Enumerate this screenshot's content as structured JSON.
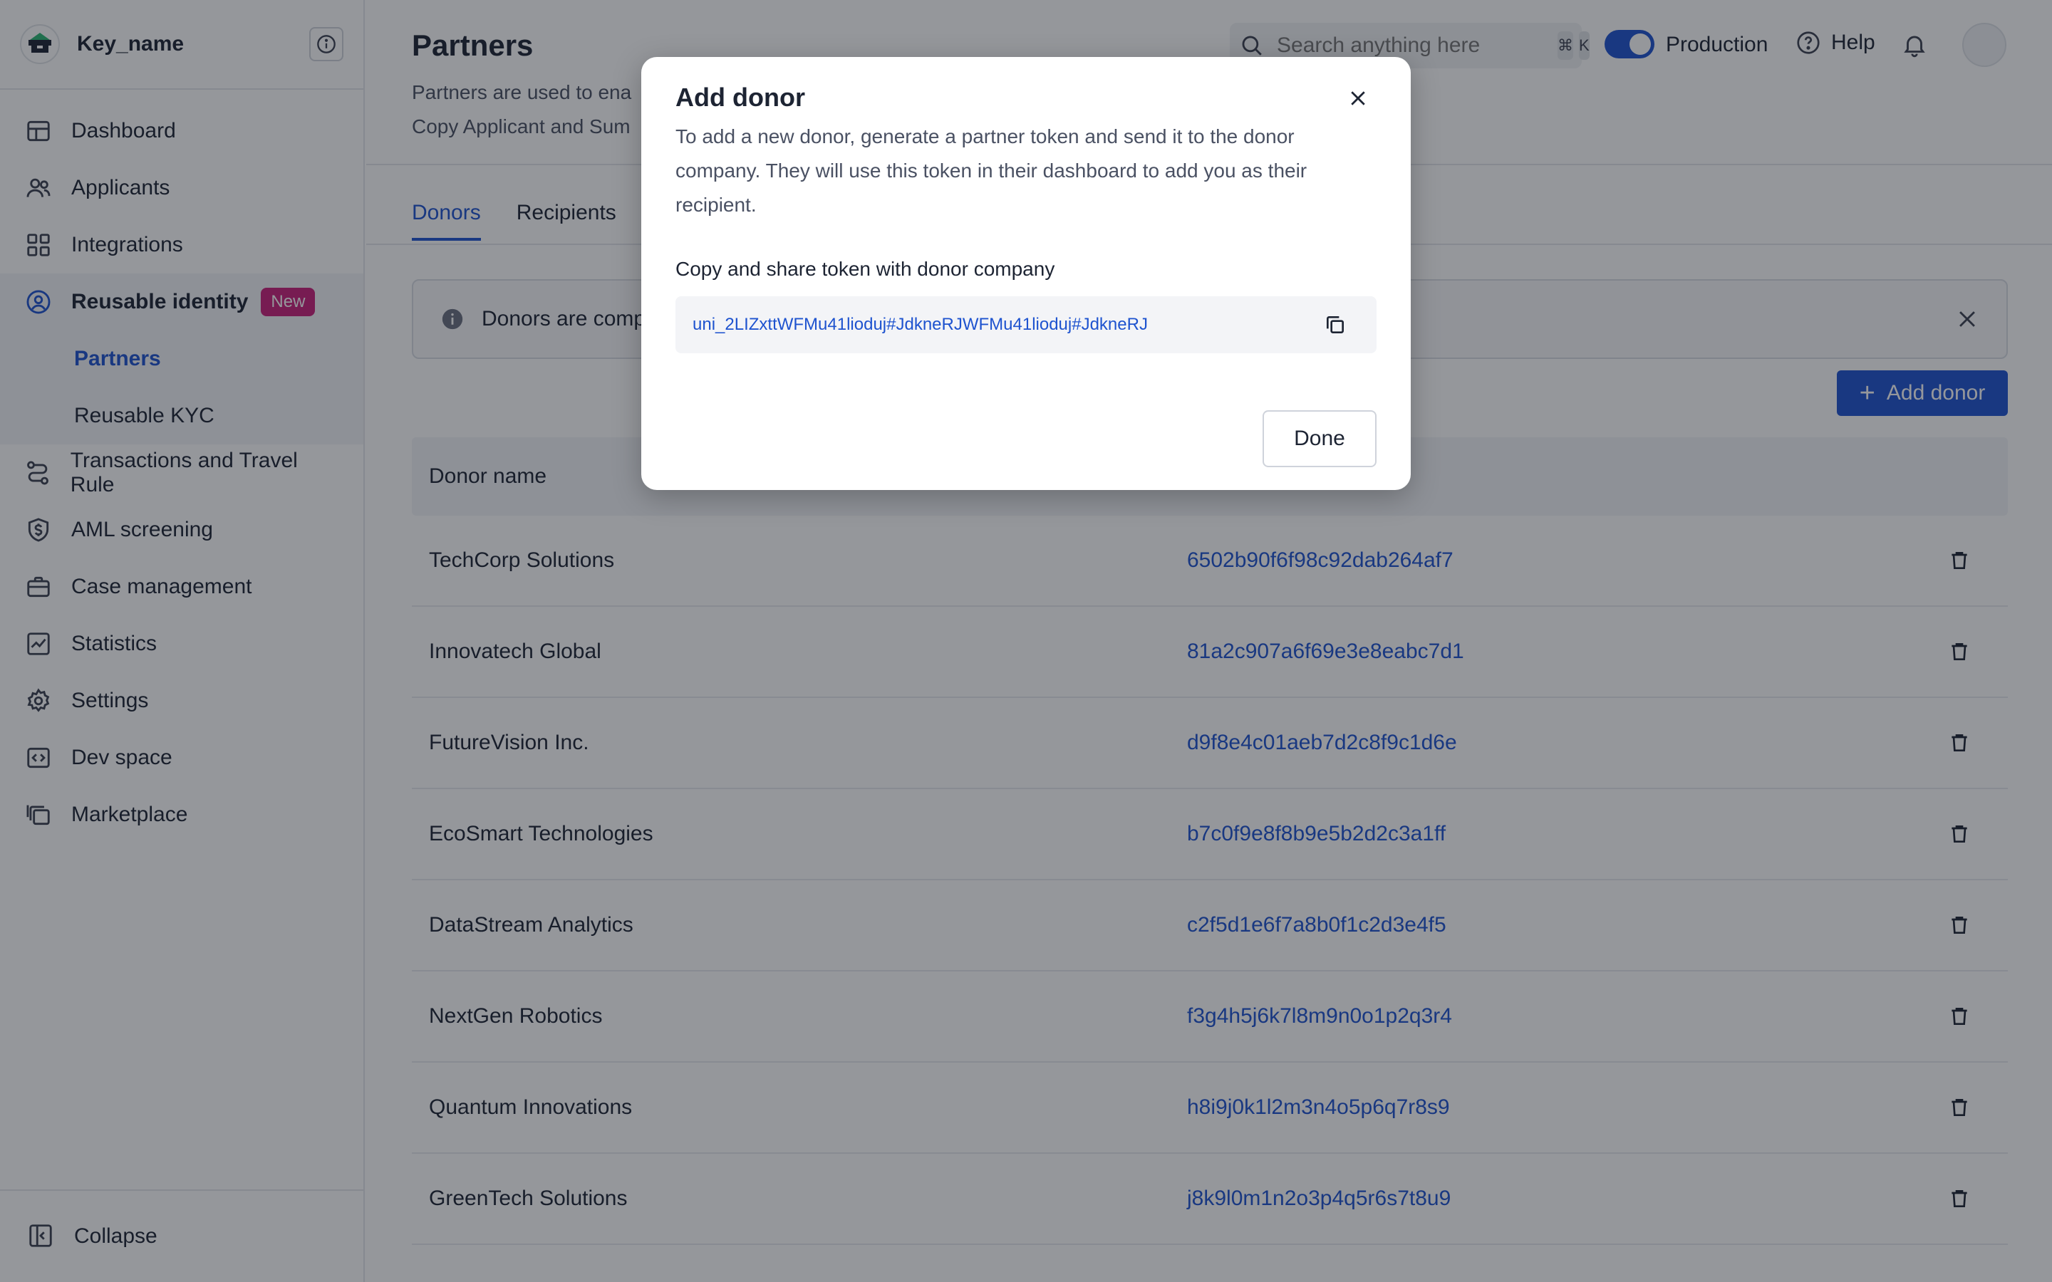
{
  "sidebar": {
    "workspace_name": "Key_name",
    "items": [
      {
        "label": "Dashboard"
      },
      {
        "label": "Applicants"
      },
      {
        "label": "Integrations"
      },
      {
        "label": "Reusable identity",
        "badge": "New"
      },
      {
        "label": "Transactions and Travel Rule"
      },
      {
        "label": "AML screening"
      },
      {
        "label": "Case management"
      },
      {
        "label": "Statistics"
      },
      {
        "label": "Settings"
      },
      {
        "label": "Dev space"
      },
      {
        "label": "Marketplace"
      }
    ],
    "sub_items": [
      {
        "label": "Partners"
      },
      {
        "label": "Reusable KYC"
      }
    ],
    "collapse_label": "Collapse"
  },
  "header": {
    "title": "Partners",
    "description_line1": "Partners are used to ena",
    "description_line2": "Copy Applicant and Sum",
    "search_placeholder": "Search anything here",
    "kbd_cmd": "⌘",
    "kbd_k": "K",
    "environment": "Production",
    "help_label": "Help"
  },
  "tabs": [
    {
      "label": "Donors"
    },
    {
      "label": "Recipients"
    }
  ],
  "notice": {
    "text": "Donors are comp"
  },
  "add_button_label": "Add donor",
  "table": {
    "column_name": "Donor name",
    "rows": [
      {
        "name": "TechCorp Solutions",
        "id": "6502b90f6f98c92dab264af7"
      },
      {
        "name": "Innovatech Global",
        "id": "81a2c907a6f69e3e8eabc7d1"
      },
      {
        "name": "FutureVision Inc.",
        "id": "d9f8e4c01aeb7d2c8f9c1d6e"
      },
      {
        "name": "EcoSmart Technologies",
        "id": "b7c0f9e8f8b9e5b2d2c3a1ff"
      },
      {
        "name": "DataStream Analytics",
        "id": "c2f5d1e6f7a8b0f1c2d3e4f5"
      },
      {
        "name": "NextGen Robotics",
        "id": "f3g4h5j6k7l8m9n0o1p2q3r4"
      },
      {
        "name": "Quantum Innovations",
        "id": "h8i9j0k1l2m3n4o5p6q7r8s9"
      },
      {
        "name": "GreenTech Solutions",
        "id": "j8k9l0m1n2o3p4q5r6s7t8u9"
      }
    ]
  },
  "modal": {
    "title": "Add donor",
    "description": "To add a new donor, generate a partner token and send it to the donor company. They will use this token in their dashboard to add you as their recipient.",
    "token_label": "Copy and share token with donor company",
    "token_value": "uni_2LIZxttWFMu41lioduj#JdkneRJWFMu41lioduj#JdkneRJ",
    "done_label": "Done"
  },
  "colors": {
    "accent": "#1e53cf",
    "badge": "#c8207a",
    "overlay": "rgba(20,24,34,0.45)"
  }
}
